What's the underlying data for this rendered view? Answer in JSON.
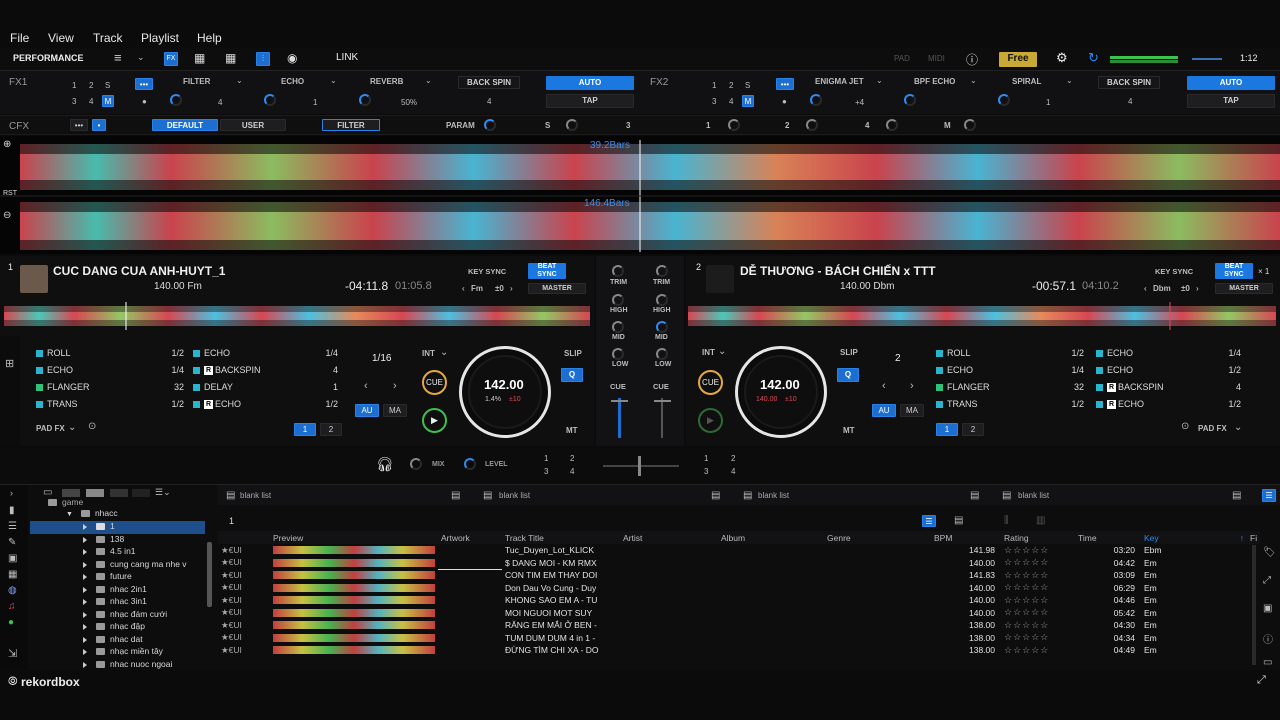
{
  "menu": [
    "File",
    "View",
    "Track",
    "Playlist",
    "Help"
  ],
  "toolbar": {
    "mode": "PERFORMANCE",
    "link": "LINK",
    "pad": "PAD",
    "midi": "MIDI",
    "plan": "Free",
    "time": "1:12"
  },
  "fx1": {
    "label": "FX1",
    "beats": [
      "1",
      "2",
      "S",
      "3",
      "4",
      "M"
    ],
    "units": [
      {
        "name": "FILTER",
        "value": "4"
      },
      {
        "name": "ECHO",
        "value": "1"
      },
      {
        "name": "REVERB",
        "value": "50%"
      }
    ],
    "beat_fx": "BACK SPIN",
    "beat_val": "4",
    "auto": "AUTO",
    "tap": "TAP"
  },
  "fx2": {
    "label": "FX2",
    "beats": [
      "1",
      "2",
      "S",
      "3",
      "4",
      "M"
    ],
    "units": [
      {
        "name": "ENIGMA JET",
        "value": "+4"
      },
      {
        "name": "BPF ECHO",
        "value": ""
      },
      {
        "name": "SPIRAL",
        "value": "1"
      }
    ],
    "beat_fx": "BACK SPIN",
    "beat_val": "4",
    "auto": "AUTO",
    "tap": "TAP"
  },
  "cfx": {
    "label": "CFX",
    "default": "DEFAULT",
    "user": "USER",
    "filter": "FILTER",
    "param": "PARAM",
    "s": "S",
    "n3": "3",
    "n1": "1",
    "n2": "2",
    "n4": "4",
    "m": "M"
  },
  "waveform": {
    "bars_top": "39.2Bars",
    "bars_bottom": "146.4Bars",
    "rst": "RST"
  },
  "deck1": {
    "num": "1",
    "title": "CUC DANG CUA ANH-HUYT_1",
    "bpm_key": "140.00  Fm",
    "remain": "-04:11.8",
    "elapsed": "01:05.8",
    "key_sync": "KEY SYNC",
    "key": "Fm",
    "key_shift": "±0",
    "beat_sync": "BEAT SYNC",
    "master": "MASTER",
    "loop": "1/16",
    "int": "INT",
    "slip": "SLIP",
    "q": "Q",
    "cue": "CUE",
    "bpm": "142.00",
    "pitch": "1.4%",
    "pitch_range": "±10",
    "au": "AU",
    "ma": "MA",
    "mt": "MT",
    "pad_fx": "PAD FX",
    "page1": "1",
    "page2": "2",
    "pads_left": [
      {
        "name": "ROLL",
        "val": "1/2"
      },
      {
        "name": "ECHO",
        "val": "1/4"
      },
      {
        "name": "FLANGER",
        "val": "32"
      },
      {
        "name": "TRANS",
        "val": "1/2"
      }
    ],
    "pads_right": [
      {
        "name": "ECHO",
        "val": "1/4",
        "r": false
      },
      {
        "name": "BACKSPIN",
        "val": "4",
        "r": true
      },
      {
        "name": "DELAY",
        "val": "1",
        "r": false
      },
      {
        "name": "ECHO",
        "val": "1/2",
        "r": true
      }
    ]
  },
  "deck2": {
    "num": "2",
    "title": "DỄ THƯƠNG - BÁCH CHIẾN x TTT",
    "bpm_key": "140.00  Dbm",
    "remain": "-00:57.1",
    "elapsed": "04:10.2",
    "key_sync": "KEY SYNC",
    "key": "Dbm",
    "key_shift": "±0",
    "beat_sync": "BEAT SYNC",
    "master": "MASTER",
    "x1": "× 1",
    "loop": "2",
    "int": "INT",
    "slip": "SLIP",
    "q": "Q",
    "cue": "CUE",
    "bpm": "142.00",
    "pitch": "140.00",
    "pitch_range": "±10",
    "au": "AU",
    "ma": "MA",
    "mt": "MT",
    "pad_fx": "PAD FX",
    "page1": "1",
    "page2": "2",
    "pads_left": [
      {
        "name": "ROLL",
        "val": "1/2"
      },
      {
        "name": "ECHO",
        "val": "1/4"
      },
      {
        "name": "FLANGER",
        "val": "32"
      },
      {
        "name": "TRANS",
        "val": "1/2"
      }
    ],
    "pads_right": [
      {
        "name": "ECHO",
        "val": "1/4",
        "r": false
      },
      {
        "name": "ECHO",
        "val": "1/2",
        "r": false
      },
      {
        "name": "BACKSPIN",
        "val": "4",
        "r": true
      },
      {
        "name": "ECHO",
        "val": "1/2",
        "r": true
      }
    ]
  },
  "mixer": {
    "trim": "TRIM",
    "high": "HIGH",
    "mid": "MID",
    "low": "LOW",
    "cue": "CUE",
    "mix": "MIX",
    "level": "LEVEL",
    "a1": "1",
    "a2": "2",
    "a3": "3",
    "a4": "4"
  },
  "browser": {
    "panels": [
      "blank list",
      "blank list",
      "blank list",
      "blank list"
    ],
    "playlist_num": "1",
    "tree": [
      {
        "label": "game",
        "level": 1,
        "open": false
      },
      {
        "label": "nhacc",
        "level": 1,
        "open": true
      },
      {
        "label": "1",
        "level": 2,
        "selected": true
      },
      {
        "label": "138",
        "level": 2
      },
      {
        "label": "4.5 in1",
        "level": 2
      },
      {
        "label": "cung cang ma nhe v",
        "level": 2
      },
      {
        "label": "future",
        "level": 2
      },
      {
        "label": "nhac 2in1",
        "level": 2
      },
      {
        "label": "nhac 3in1",
        "level": 2
      },
      {
        "label": "nhạc đám cưới",
        "level": 2
      },
      {
        "label": "nhạc đập",
        "level": 2
      },
      {
        "label": "nhac dat",
        "level": 2
      },
      {
        "label": "nhạc miền tây",
        "level": 2
      },
      {
        "label": "nhac nuoc ngoai",
        "level": 2
      }
    ],
    "columns": [
      "Preview",
      "Artwork",
      "Track Title",
      "Artist",
      "Album",
      "Genre",
      "BPM",
      "Rating",
      "Time",
      "Key",
      "Fi"
    ],
    "rows": [
      {
        "title": "Tuc_Duyen_Lot_KLICK",
        "bpm": "141.98",
        "time": "03:20",
        "key": "Ebm"
      },
      {
        "title": "$ DANG MOI - KM RMX",
        "bpm": "140.00",
        "time": "04:42",
        "key": "Em"
      },
      {
        "title": "CON TIM EM THAY DOI",
        "bpm": "141.83",
        "time": "03:09",
        "key": "Em"
      },
      {
        "title": "Don Dau Vo Cung - Duy",
        "bpm": "140.00",
        "time": "06:29",
        "key": "Em"
      },
      {
        "title": "KHONG SAO EM A - TU",
        "bpm": "140.00",
        "time": "04:46",
        "key": "Em"
      },
      {
        "title": "MOI NGUOI MOT SUY",
        "bpm": "140.00",
        "time": "05:42",
        "key": "Em"
      },
      {
        "title": "RĂNG EM MẮI Ở BEN -",
        "bpm": "138.00",
        "time": "04:30",
        "key": "Em"
      },
      {
        "title": "TUM DUM DUM 4 in 1 -",
        "bpm": "138.00",
        "time": "04:34",
        "key": "Em"
      },
      {
        "title": "ĐỪNG TÌM CHI XA - DO",
        "bpm": "138.00",
        "time": "04:49",
        "key": "Em"
      }
    ],
    "row_prefix": "★€UI"
  },
  "brand": "rekordbox",
  "colors": {
    "accent": "#1c78e0",
    "cue": "#e8a83a",
    "play": "#3cc24a",
    "pad": "#28b5d0",
    "free": "#d6b53a"
  }
}
